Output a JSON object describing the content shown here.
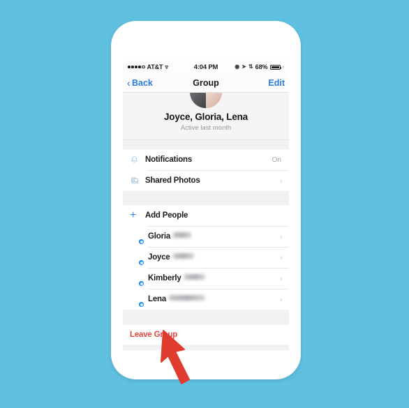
{
  "background_color": "#5fc0e0",
  "device": {
    "frame_color": "#ffffff"
  },
  "status_bar": {
    "carrier": "AT&T",
    "wifi_icon": "wifi-icon",
    "time": "4:04 PM",
    "alarm_icon": "alarm-icon",
    "location_icon": "location-arrow-icon",
    "bluetooth_icon": "bluetooth-icon",
    "battery_percent": "68%",
    "battery_icon": "battery-icon"
  },
  "nav_bar": {
    "back_label": "Back",
    "back_icon": "chevron-left-icon",
    "title": "Group",
    "edit_label": "Edit",
    "tint_color": "#2a7bdd"
  },
  "group_header": {
    "avatar_icon": "group-avatar",
    "name": "Joyce, Gloria, Lena",
    "status": "Active last month"
  },
  "settings": [
    {
      "label": "Notifications",
      "icon": "bell-icon",
      "value": "On",
      "has_chevron": false
    },
    {
      "label": "Shared Photos",
      "icon": "photos-icon",
      "value": "",
      "has_chevron": true
    }
  ],
  "add_people": {
    "label": "Add People",
    "icon": "plus-icon"
  },
  "members": [
    {
      "first_name": "Gloria",
      "last_name_blurred": true,
      "blur_width": 26,
      "badge_icon": "messenger-badge-icon"
    },
    {
      "first_name": "Joyce",
      "last_name_blurred": true,
      "blur_width": 30,
      "badge_icon": "messenger-badge-icon"
    },
    {
      "first_name": "Kimberly",
      "last_name_blurred": true,
      "blur_width": 30,
      "badge_icon": "messenger-badge-icon"
    },
    {
      "first_name": "Lena",
      "last_name_blurred": true,
      "blur_width": 52,
      "badge_icon": "messenger-badge-icon"
    }
  ],
  "leave_group": {
    "label": "Leave Group",
    "color": "#e0483f"
  },
  "annotation": {
    "arrow_icon": "red-arrow-pointer",
    "color": "#e03b2f",
    "points_to": "Leave Group"
  }
}
